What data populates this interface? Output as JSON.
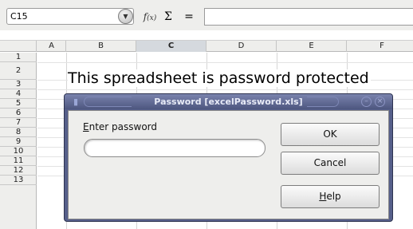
{
  "formula_bar": {
    "name_box_value": "C15",
    "name_box_dropdown_icon": "chevron-down-icon",
    "function_wizard_icon": "function-wizard-icon",
    "fx_glyph": "f",
    "fx_sub": "(x)",
    "sum_icon": "sum-icon",
    "sum_glyph": "Σ",
    "equals_glyph": "=",
    "formula_value": ""
  },
  "grid": {
    "columns": [
      "A",
      "B",
      "C",
      "D",
      "E",
      "F"
    ],
    "active_column": "C",
    "rows": [
      "1",
      "2",
      "3",
      "4",
      "5",
      "6",
      "7",
      "8",
      "9",
      "10",
      "11",
      "12",
      "13"
    ],
    "cell_b2_text": "This spreadsheet is password protected"
  },
  "dialog": {
    "title": "Password [excelPassword.xls]",
    "label_prefix": "E",
    "label_rest": "nter password",
    "password_value": "",
    "ok_label": "OK",
    "cancel_label": "Cancel",
    "help_mnemonic": "H",
    "help_rest": "elp",
    "titlebar_menu_icon": "window-menu-icon",
    "minimize_icon": "minimize-icon",
    "close_icon": "close-icon"
  },
  "colors": {
    "dialog_frame": "#565f8a",
    "dialog_body": "#eeeeec",
    "toolbar_bg": "#eeeeec",
    "active_column_header": "#d5d9de"
  }
}
